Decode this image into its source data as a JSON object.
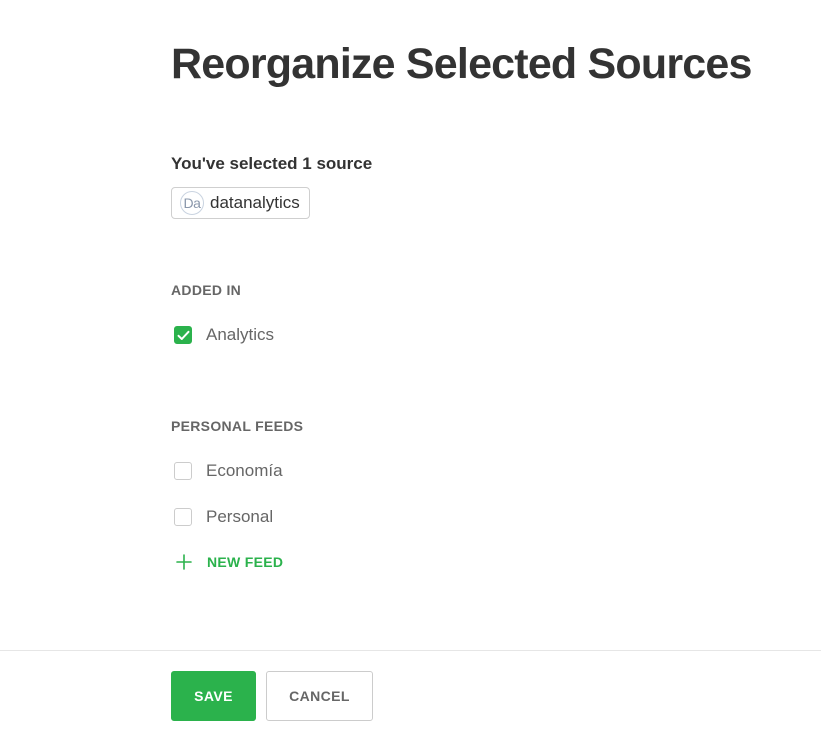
{
  "header": {
    "title": "Reorganize Selected Sources"
  },
  "selection": {
    "heading": "You've selected 1 source",
    "source": {
      "avatar_text": "Da",
      "name": "datanalytics"
    }
  },
  "added_in": {
    "label": "ADDED IN",
    "items": [
      {
        "label": "Analytics",
        "checked": true
      }
    ]
  },
  "personal_feeds": {
    "label": "PERSONAL FEEDS",
    "items": [
      {
        "label": "Economía",
        "checked": false
      },
      {
        "label": "Personal",
        "checked": false
      }
    ],
    "new_feed_label": "NEW FEED"
  },
  "actions": {
    "save_label": "SAVE",
    "cancel_label": "CANCEL"
  },
  "colors": {
    "accent": "#2bb24c",
    "text": "#333333",
    "muted": "#666666"
  },
  "icons": {
    "check": "check-icon",
    "plus": "plus-icon"
  }
}
